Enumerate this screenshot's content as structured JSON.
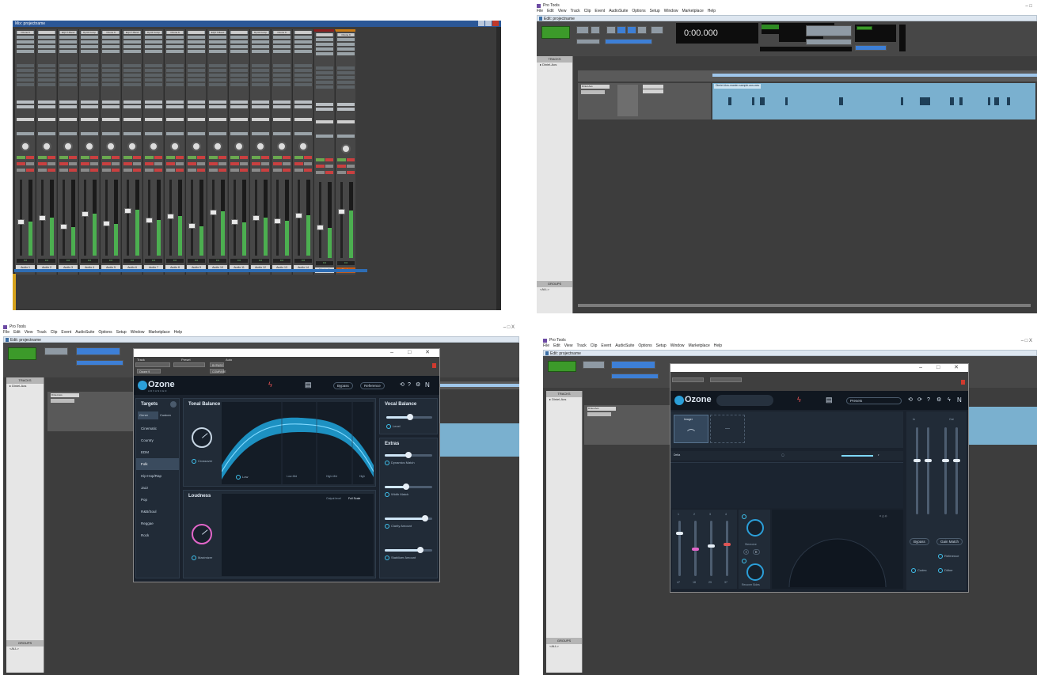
{
  "q1": {
    "title": "Mix: projectname",
    "strips": [
      {
        "name": "Audio 1",
        "plugin": "Ozone 9",
        "level": 0.45
      },
      {
        "name": "Audio 2",
        "plugin": "",
        "level": 0.5
      },
      {
        "name": "Audio 3",
        "plugin": "EQ3 7-Band",
        "level": 0.38
      },
      {
        "name": "Audio 4",
        "plugin": "Dyn3 Comp",
        "level": 0.55
      },
      {
        "name": "Audio 5",
        "plugin": "Ozone 9",
        "level": 0.42
      },
      {
        "name": "Audio 6",
        "plugin": "EQ3 7-Band",
        "level": 0.6
      },
      {
        "name": "Audio 7",
        "plugin": "Dyn3 Comp",
        "level": 0.47
      },
      {
        "name": "Audio 8",
        "plugin": "Ozone 9",
        "level": 0.52
      },
      {
        "name": "Audio 9",
        "plugin": "",
        "level": 0.39
      },
      {
        "name": "Audio 10",
        "plugin": "EQ3 7-Band",
        "level": 0.58
      },
      {
        "name": "Audio 11",
        "plugin": "",
        "level": 0.44
      },
      {
        "name": "Audio 12",
        "plugin": "Dyn3 Comp",
        "level": 0.5
      },
      {
        "name": "Audio 13",
        "plugin": "Ozone 9",
        "level": 0.46
      },
      {
        "name": "Audio 14",
        "plugin": "",
        "level": 0.53
      },
      {
        "name": "Master 1",
        "plugin": "",
        "level": 0.4
      },
      {
        "name": "Master",
        "plugin": "Ozone 9",
        "level": 0.62
      }
    ]
  },
  "q2": {
    "app_title": "Pro Tools",
    "menu": [
      "File",
      "Edit",
      "View",
      "Track",
      "Clip",
      "Event",
      "AudioSuite",
      "Options",
      "Setup",
      "Window",
      "Marketplace",
      "Help"
    ],
    "edit_title": "Edit: projectname",
    "counter": "0:00.000",
    "tracks_label": "TRACKS",
    "track_name": "Diniel-Aos",
    "groups_label": "GROUPS",
    "group_item": "<ALL>",
    "clip_name": "Dimiel-Aos-master-sample-aos.wav",
    "win_controls": "– □"
  },
  "q3": {
    "app_title": "Pro Tools",
    "menu": [
      "File",
      "Edit",
      "View",
      "Track",
      "Clip",
      "Event",
      "AudioSuite",
      "Options",
      "Setup",
      "Window",
      "Marketplace",
      "Help"
    ],
    "edit_title": "Edit: projectname",
    "plugin_title": "",
    "header": {
      "track": "Track",
      "preset": "Preset",
      "auto": "Auto",
      "insert": "Ozone 9",
      "bypass": "BYPASS",
      "compare": "COMPARE"
    },
    "ozone": {
      "logo": "Ozone",
      "logo_sub": "ADVANCED",
      "bypass": "Bypass",
      "reference": "Reference",
      "targets_title": "Targets",
      "tab_genre": "Genre",
      "tab_custom": "Custom",
      "genres": [
        "Cinematic",
        "Country",
        "EDM",
        "Folk",
        "Hip-Hop/Rap",
        "Jazz",
        "Pop",
        "R&B/Soul",
        "Reggae",
        "Rock"
      ],
      "selected_genre": "Folk",
      "tonal_title": "Tonal Balance",
      "crossover": "Crossover",
      "bands": [
        "Low",
        "Low-Mid",
        "High-Mid",
        "High"
      ],
      "loudness_title": "Loudness",
      "output_label": "Output level",
      "output_value": "Full Scale",
      "maximizer": "Maximizer",
      "vocal_title": "Vocal Balance",
      "vocal_level": "Level",
      "extras_title": "Extras",
      "extras": [
        {
          "label": "Dynamics Match",
          "value": 0.5
        },
        {
          "label": "Width Match",
          "value": 0.45
        },
        {
          "label": "Clarity Amount",
          "value": 0.85
        },
        {
          "label": "Stabilizer Amount",
          "value": 0.75
        }
      ]
    },
    "tracks_label": "TRACKS",
    "groups_label": "GROUPS",
    "group_item": "<ALL>",
    "track_name": "Diniel-Aos",
    "win_controls": "– □ X"
  },
  "q4": {
    "app_title": "Pro Tools",
    "menu": [
      "File",
      "Edit",
      "View",
      "Track",
      "Clip",
      "Event",
      "AudioSuite",
      "Options",
      "Setup",
      "Window",
      "Marketplace",
      "Help"
    ],
    "edit_title": "Edit: projectname",
    "ozone": {
      "logo": "Ozone",
      "module_title": "Imager",
      "presets": "Presets",
      "delta": "Delta",
      "band_numbers": [
        "1",
        "2",
        "3",
        "4"
      ],
      "band_values": [
        "47",
        "18",
        "29",
        "37"
      ],
      "width_label": "Width",
      "stereoize": "Stereoize",
      "mode_label": "I",
      "mode_label2": "II",
      "recover": "Recover Sides",
      "gain_labels": [
        "In",
        "Out"
      ],
      "bypass": "Bypass",
      "gain_match": "Gain Match",
      "reference": "Reference",
      "codec": "Codec",
      "dither": "Dither"
    },
    "tracks_label": "TRACKS",
    "groups_label": "GROUPS",
    "group_item": "<ALL>",
    "track_name": "Diniel-Aos",
    "win_controls": "– □ X"
  }
}
